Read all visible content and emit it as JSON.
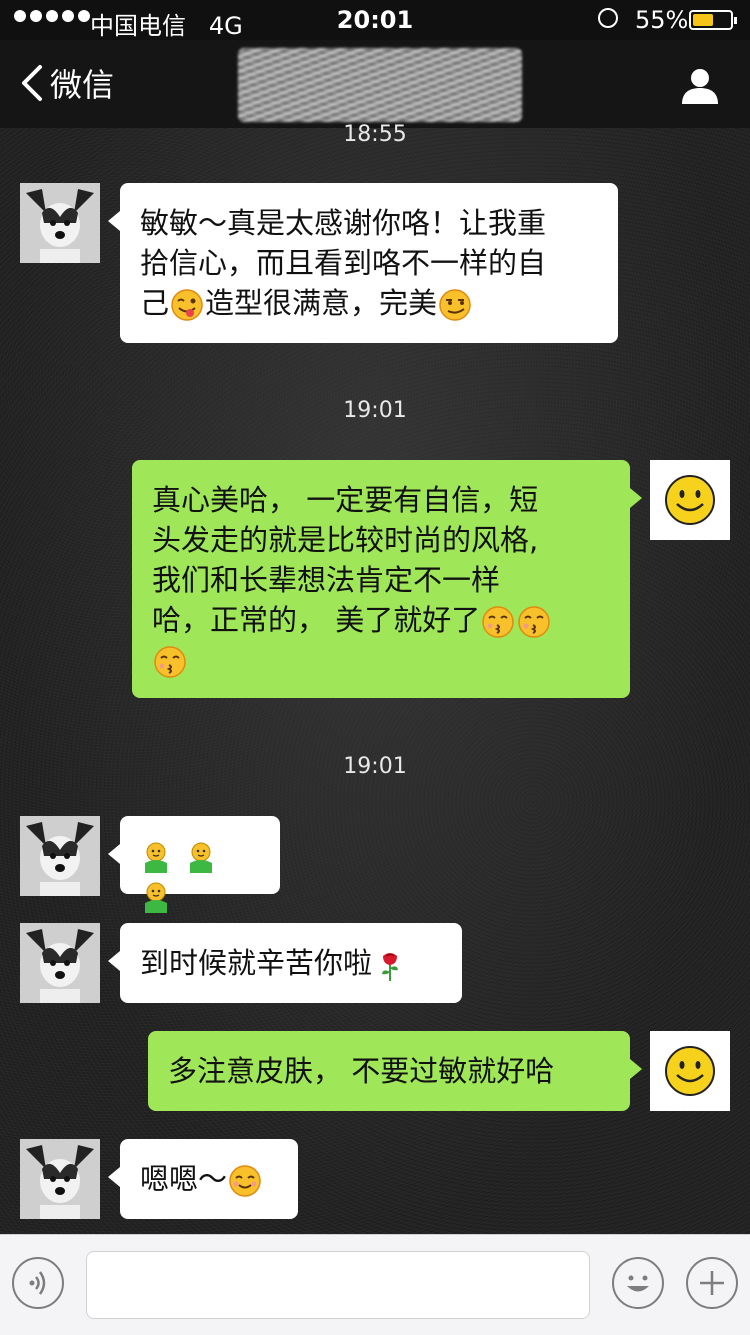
{
  "status_bar": {
    "carrier": "中国电信",
    "network": "4G",
    "time": "20:01",
    "battery_percent_label": "55%",
    "battery_level": 0.55
  },
  "nav": {
    "back_label": "微信",
    "back_icon": "chevron-left-icon",
    "profile_icon": "person-icon"
  },
  "messages": [
    {
      "type": "timestamp",
      "text": "18:55"
    },
    {
      "type": "incoming",
      "lines": [
        "敏敏～真是太感谢你咯！让我重",
        "拾信心，而且看到咯不一样的自",
        "己",
        "造型很满意，完美"
      ],
      "emojis": [
        "wink-tongue-emoji",
        "smug-emoji"
      ]
    },
    {
      "type": "timestamp",
      "text": "19:01"
    },
    {
      "type": "outgoing",
      "lines": [
        "真心美哈， 一定要有自信，短",
        "头发走的就是比较时尚的风格,",
        " 我们和长辈想法肯定不一样",
        "哈，正常的， 美了就好了"
      ],
      "emojis": [
        "kiss-emoji",
        "kiss-emoji",
        "kiss-emoji"
      ]
    },
    {
      "type": "timestamp",
      "text": "19:01"
    },
    {
      "type": "incoming",
      "lines": [],
      "emojis": [
        "green-figure-emoji",
        "green-figure-emoji",
        "green-figure-emoji"
      ]
    },
    {
      "type": "incoming",
      "lines": [
        "到时候就辛苦你啦"
      ],
      "emojis": [
        "rose-emoji"
      ]
    },
    {
      "type": "outgoing",
      "lines": [
        "多注意皮肤， 不要过敏就好哈"
      ],
      "emojis": []
    },
    {
      "type": "incoming",
      "lines": [
        "嗯嗯～"
      ],
      "emojis": [
        "smile-emoji"
      ]
    }
  ],
  "input_bar": {
    "voice_icon": "voice-icon",
    "emoji_icon": "emoji-icon",
    "plus_icon": "plus-icon",
    "text_value": ""
  },
  "colors": {
    "outgoing_bubble": "#9fe658",
    "incoming_bubble": "#ffffff",
    "battery": "#f5c518"
  }
}
